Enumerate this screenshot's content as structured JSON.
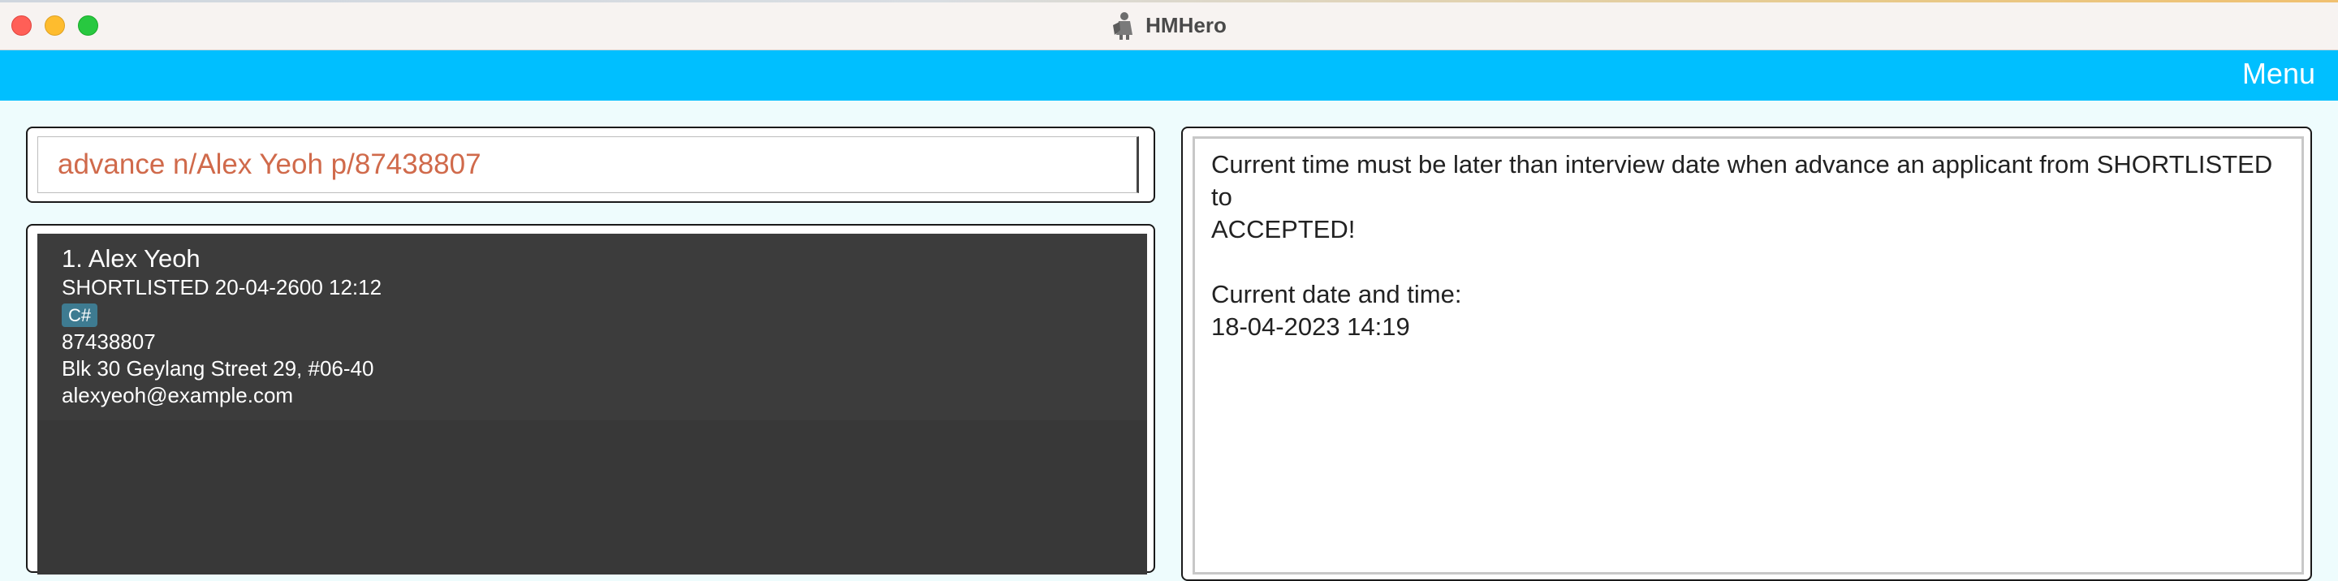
{
  "window": {
    "title": "HMHero",
    "app_icon": "knight-icon"
  },
  "menubar": {
    "menu_label": "Menu"
  },
  "command_box": {
    "value": "advance n/Alex Yeoh p/87438807"
  },
  "applicants": [
    {
      "index": "1.",
      "name": "Alex Yeoh",
      "status_line": "SHORTLISTED 20-04-2600 12:12",
      "tags": [
        "C#"
      ],
      "phone": "87438807",
      "address": "Blk 30 Geylang Street 29, #06-40",
      "email": "alexyeoh@example.com"
    }
  ],
  "result_display": {
    "message_line1": "Current time must be later than interview date when advance an applicant from SHORTLISTED to",
    "message_line2": "ACCEPTED!",
    "label": "Current date and time:",
    "datetime": "18-04-2023 14:19"
  },
  "colors": {
    "menubar_bg": "#00bfff",
    "command_text": "#d06a4b",
    "list_bg": "#383838",
    "tag_bg": "#3e7b91"
  }
}
